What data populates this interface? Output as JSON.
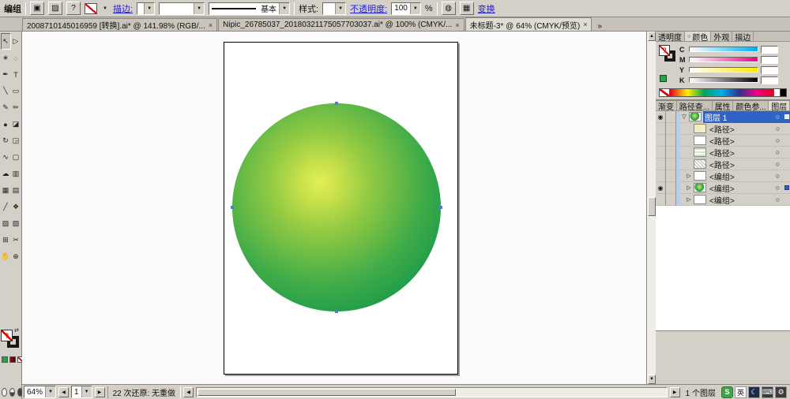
{
  "icons": {
    "dropdown": "▼",
    "up": "▲",
    "left": "◀",
    "right": "▶",
    "close": "×",
    "overflow": "»",
    "eye": "◉",
    "target": "○",
    "expand_open": "▽",
    "expand_closed": "▷",
    "swap": "⇄",
    "question": "?"
  },
  "control_bar": {
    "context_label": "编组",
    "appearance_icon": "▣",
    "graphic_style_icon": "▨",
    "help_label": "?",
    "stroke_link": "描边:",
    "brush_definition": "基本",
    "style_label": "样式:",
    "opacity_link": "不透明度:",
    "opacity_value": "100",
    "percent_sign": "%",
    "recolor_icon": "◍",
    "align_icon": "▦",
    "transform_link": "变换"
  },
  "document_tabs": [
    {
      "title": "2008710145016959 [转换].ai* @ 141.98% (RGB/..."
    },
    {
      "title": "Nipic_26785037_20180321175057703037.ai* @ 100% (CMYK/..."
    },
    {
      "title": "未标题-3* @ 64% (CMYK/预览)"
    }
  ],
  "tools": [
    {
      "name": "selection",
      "glyph": "↖"
    },
    {
      "name": "direct-selection",
      "glyph": "▷"
    },
    {
      "name": "magic-wand",
      "glyph": "∗"
    },
    {
      "name": "lasso",
      "glyph": "◌"
    },
    {
      "name": "pen",
      "glyph": "✒"
    },
    {
      "name": "type",
      "glyph": "T"
    },
    {
      "name": "line-segment",
      "glyph": "╲"
    },
    {
      "name": "rectangle",
      "glyph": "▭"
    },
    {
      "name": "paintbrush",
      "glyph": "✎"
    },
    {
      "name": "pencil",
      "glyph": "✏"
    },
    {
      "name": "blob-brush",
      "glyph": "●"
    },
    {
      "name": "eraser",
      "glyph": "◪"
    },
    {
      "name": "rotate",
      "glyph": "↻"
    },
    {
      "name": "scale",
      "glyph": "◲"
    },
    {
      "name": "width",
      "glyph": "∿"
    },
    {
      "name": "free-transform",
      "glyph": "▢"
    },
    {
      "name": "symbol-sprayer",
      "glyph": "☁"
    },
    {
      "name": "column-graph",
      "glyph": "▥"
    },
    {
      "name": "mesh",
      "glyph": "▦"
    },
    {
      "name": "gradient",
      "glyph": "▤"
    },
    {
      "name": "eyedropper",
      "glyph": "╱"
    },
    {
      "name": "blend",
      "glyph": "❖"
    },
    {
      "name": "live-paint-bucket",
      "glyph": "▨"
    },
    {
      "name": "live-paint-selection",
      "glyph": "▧"
    },
    {
      "name": "artboard",
      "glyph": "⊞"
    },
    {
      "name": "slice",
      "glyph": "✂"
    },
    {
      "name": "hand",
      "glyph": "✋"
    },
    {
      "name": "zoom",
      "glyph": "⊕"
    }
  ],
  "color_panel": {
    "tabs": {
      "transparency": "透明度",
      "color": "颜色",
      "appearance": "外观",
      "stroke": "描边"
    },
    "sliders": {
      "c": "C",
      "m": "M",
      "y": "Y",
      "k": "K"
    }
  },
  "layers_panel": {
    "tabs": {
      "gradient": "渐变",
      "pathfinder": "路径查...",
      "attributes": "属性",
      "color_guide": "颜色参...",
      "layers": "图层"
    },
    "rows": [
      {
        "label": "图层 1",
        "visible": true,
        "expanded": true,
        "selected": true
      },
      {
        "label": "<路径>",
        "visible": false
      },
      {
        "label": "<路径>",
        "visible": false
      },
      {
        "label": "<路径>",
        "visible": false
      },
      {
        "label": "<路径>",
        "visible": false
      },
      {
        "label": "<编组>",
        "visible": false
      },
      {
        "label": "<编组>",
        "visible": true,
        "selected": true
      },
      {
        "label": "<编组>",
        "visible": false
      }
    ]
  },
  "canvas": {
    "sphere": {
      "center_color": "#dde94e",
      "edge_color": "#12994a"
    }
  },
  "status_bar": {
    "zoom": "64%",
    "artboard_number": "1",
    "undo_status": "22 次还原: 无重做",
    "layer_count": "1 个图层"
  },
  "tray": {
    "sogou": "S",
    "lang": "英",
    "moon": "☾",
    "keyboard": "⌨",
    "gear": "⚙"
  }
}
